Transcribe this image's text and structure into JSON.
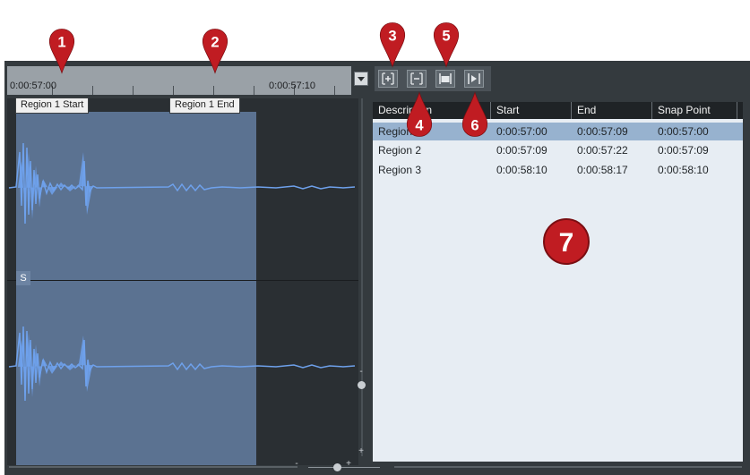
{
  "ruler": {
    "start_time": "0:00:57:00",
    "mid_time": "0:00:57:10"
  },
  "waveform": {
    "region_start_label": "Region 1 Start",
    "region_end_label": "Region 1 End",
    "split_marker": "S"
  },
  "sliders": {
    "minus": "-",
    "plus": "+"
  },
  "toolbar": {
    "buttons": [
      {
        "icon": "add-region-icon"
      },
      {
        "icon": "remove-region-icon"
      },
      {
        "icon": "set-range-icon"
      },
      {
        "icon": "play-region-icon"
      }
    ]
  },
  "list": {
    "columns": [
      "Description",
      "Start",
      "End",
      "Snap Point"
    ],
    "rows": [
      {
        "description": "Region 1",
        "start": "0:00:57:00",
        "end": "0:00:57:09",
        "snap": "0:00:57:00",
        "selected": true
      },
      {
        "description": "Region 2",
        "start": "0:00:57:09",
        "end": "0:00:57:22",
        "snap": "0:00:57:09",
        "selected": false
      },
      {
        "description": "Region 3",
        "start": "0:00:58:10",
        "end": "0:00:58:17",
        "snap": "0:00:58:10",
        "selected": false
      }
    ]
  },
  "callouts": [
    "1",
    "2",
    "3",
    "4",
    "5",
    "6",
    "7"
  ],
  "colors": {
    "callout": "#c01c22",
    "selection": "#5b7291",
    "wave": "#6ea1ec",
    "list_selected": "#97b2cf"
  }
}
